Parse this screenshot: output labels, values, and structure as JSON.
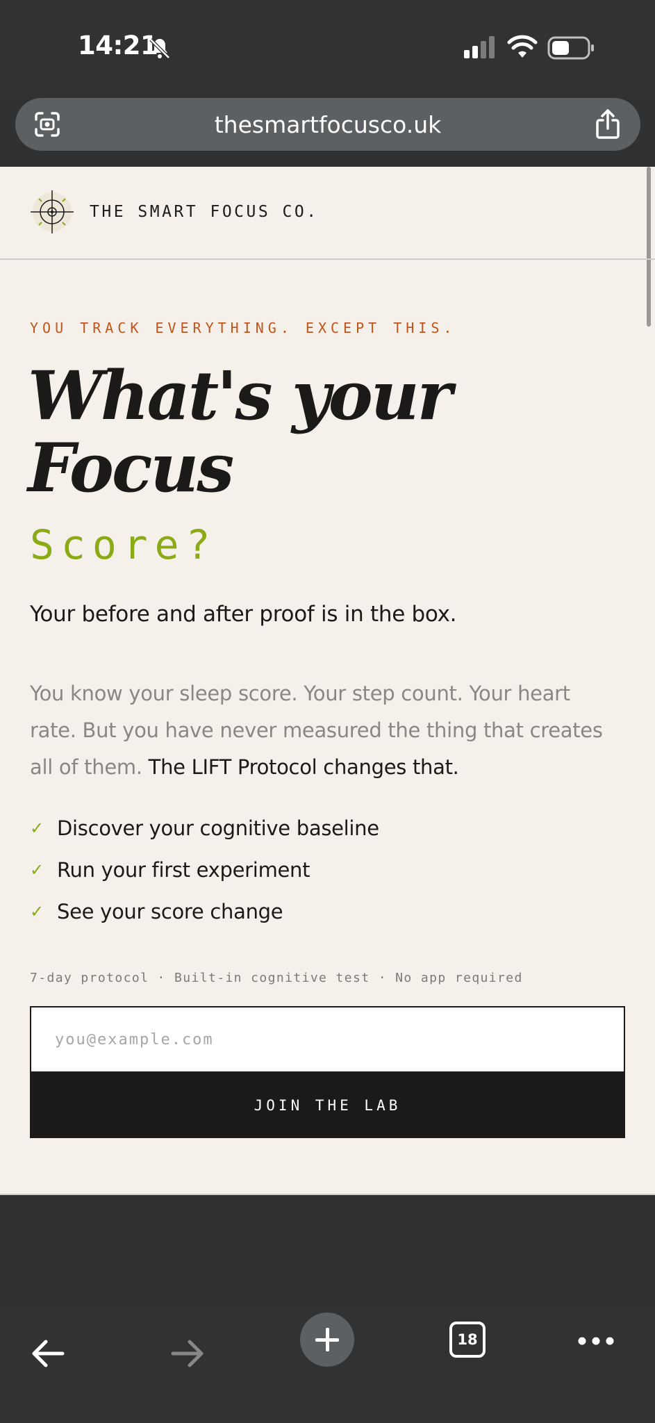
{
  "status_bar": {
    "time": "14:21"
  },
  "browser": {
    "url": "thesmartfocusco.uk",
    "tab_count": "18"
  },
  "site": {
    "brand": "THE SMART FOCUS CO."
  },
  "hero": {
    "eyebrow": "YOU TRACK EVERYTHING. EXCEPT THIS.",
    "headline_line1": "What's your",
    "headline_line2": "Focus",
    "score_word": "Score?",
    "subheadline": "Your before and after proof is in the box.",
    "body_plain": "You know your sleep score. Your step count. Your heart rate. But you have never measured the thing that creates all of them.",
    "body_bold": "The LIFT Protocol changes that.",
    "checklist": [
      "Discover your cognitive baseline",
      "Run your first experiment",
      "See your score change"
    ],
    "check_mark": "✓",
    "meta": "7-day protocol · Built-in cognitive test · No app required"
  },
  "signup": {
    "email_placeholder": "you@example.com",
    "button_label": "JOIN THE LAB"
  },
  "colors": {
    "accent_green": "#8aaa16",
    "eyebrow_orange": "#c0541a",
    "ink": "#1b1a18",
    "page_bg": "#f5f0ea"
  }
}
